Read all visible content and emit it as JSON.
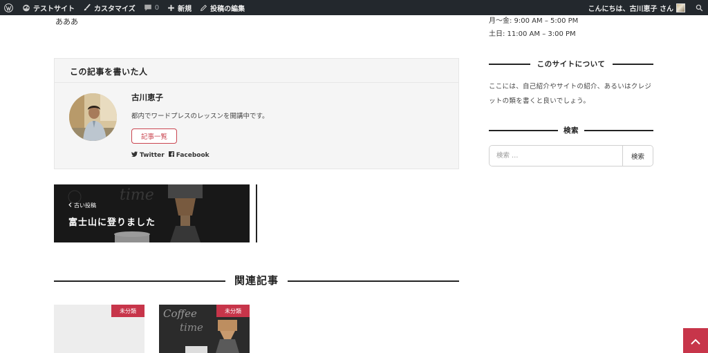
{
  "admin_bar": {
    "site_name": "テストサイト",
    "customize": "カスタマイズ",
    "comments_count": "0",
    "new_label": "新規",
    "edit_post": "投稿の編集",
    "greeting": "こんにちは、古川恵子 さん"
  },
  "main": {
    "body_text": "あああ",
    "author_box": {
      "heading": "この記事を書いた人",
      "name": "古川恵子",
      "description": "都内でワードプレスのレッスンを開講中です。",
      "posts_button": "記事一覧",
      "twitter": "Twitter",
      "facebook": "Facebook"
    },
    "prev_post": {
      "label": "古い投稿",
      "title": "富士山に登りました"
    },
    "related": {
      "heading": "関連記事",
      "cards": [
        {
          "badge": "未分類"
        },
        {
          "badge": "未分類"
        }
      ]
    }
  },
  "sidebar": {
    "hours_weekday": "月〜金: 9:00 AM – 5:00 PM",
    "hours_weekend": "土日: 11:00 AM – 3:00 PM",
    "about_heading": "このサイトについて",
    "about_text": "ここには、自己紹介やサイトの紹介、あるいはクレジットの類を書くと良いでしょう。",
    "search_heading": "検索",
    "search_placeholder": "検索 …",
    "search_button": "検索"
  },
  "colors": {
    "admin_bar_bg": "#23282d",
    "accent": "#c7354a",
    "button_border": "#c9444f"
  }
}
